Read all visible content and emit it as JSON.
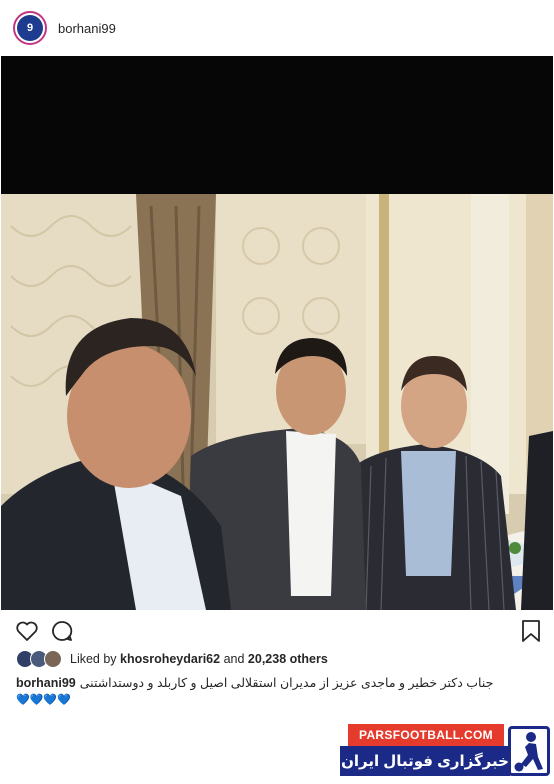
{
  "header": {
    "username": "borhani99",
    "avatar_text": "9"
  },
  "photo": {
    "description_icon": "photo"
  },
  "actions": {
    "like_icon": "heart-outline-icon",
    "comment_icon": "comment-bubble-icon",
    "save_icon": "bookmark-icon"
  },
  "likes": {
    "prefix": "Liked by",
    "user": "khosroheydari62",
    "middle": "and",
    "count": "20,238 others"
  },
  "caption": {
    "username": "borhani99",
    "text": "جناب دکتر خطیر و ماجدی عزیز از مدیران استقلالی اصیل و کاربلد و دوستداشتنی",
    "emoji": "💙💙💙💙"
  },
  "watermark": {
    "site": "PARSFOOTBALL.COM",
    "name": "خبرگزاری فوتبال ایران"
  },
  "colors": {
    "accent_story_ring": "#c13584",
    "watermark_red": "#e53b2c",
    "watermark_blue": "#1a2a86",
    "heart_emoji": "#1fb8c9"
  }
}
